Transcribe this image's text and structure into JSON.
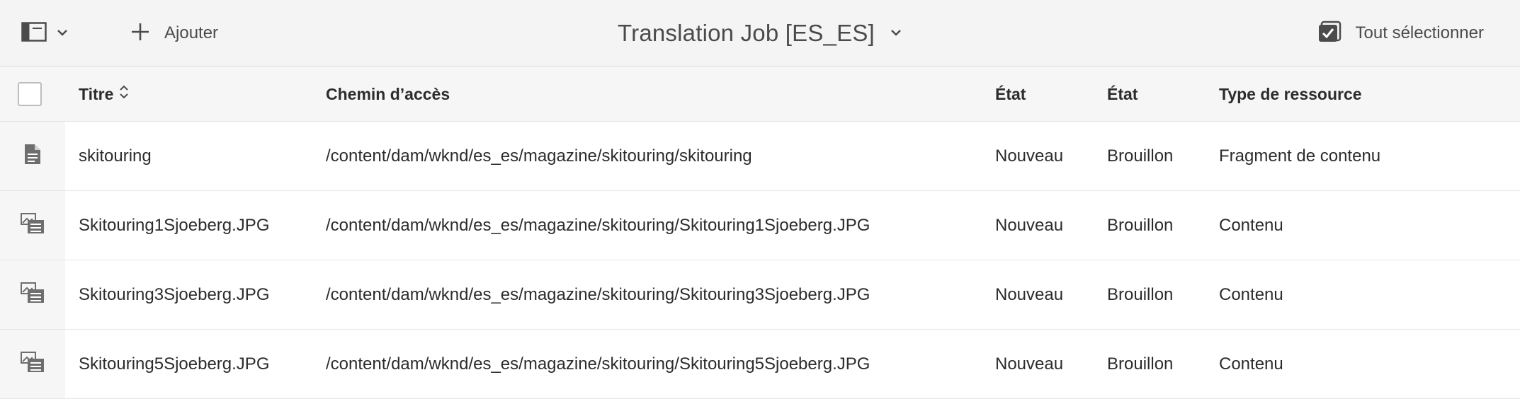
{
  "toolbar": {
    "rail_icon": "sidebar-panel-icon",
    "add_icon": "plus-icon",
    "add_label": "Ajouter",
    "title": "Translation Job [ES_ES]",
    "select_all_icon": "checkbox-select-all-icon",
    "select_all_label": "Tout sélectionner"
  },
  "table": {
    "headers": {
      "title": "Titre",
      "path": "Chemin d’accès",
      "state1": "État",
      "state2": "État",
      "type": "Type de ressource"
    },
    "rows": [
      {
        "icon": "document-icon",
        "title": "skitouring",
        "path": "/content/dam/wknd/es_es/magazine/skitouring/skitouring",
        "state1": "Nouveau",
        "state2": "Brouillon",
        "type": "Fragment de contenu"
      },
      {
        "icon": "image-asset-icon",
        "title": "Skitouring1Sjoeberg.JPG",
        "path": "/content/dam/wknd/es_es/magazine/skitouring/Skitouring1Sjoeberg.JPG",
        "state1": "Nouveau",
        "state2": "Brouillon",
        "type": "Contenu"
      },
      {
        "icon": "image-asset-icon",
        "title": "Skitouring3Sjoeberg.JPG",
        "path": "/content/dam/wknd/es_es/magazine/skitouring/Skitouring3Sjoeberg.JPG",
        "state1": "Nouveau",
        "state2": "Brouillon",
        "type": "Contenu"
      },
      {
        "icon": "image-asset-icon",
        "title": "Skitouring5Sjoeberg.JPG",
        "path": "/content/dam/wknd/es_es/magazine/skitouring/Skitouring5Sjoeberg.JPG",
        "state1": "Nouveau",
        "state2": "Brouillon",
        "type": "Contenu"
      }
    ]
  }
}
